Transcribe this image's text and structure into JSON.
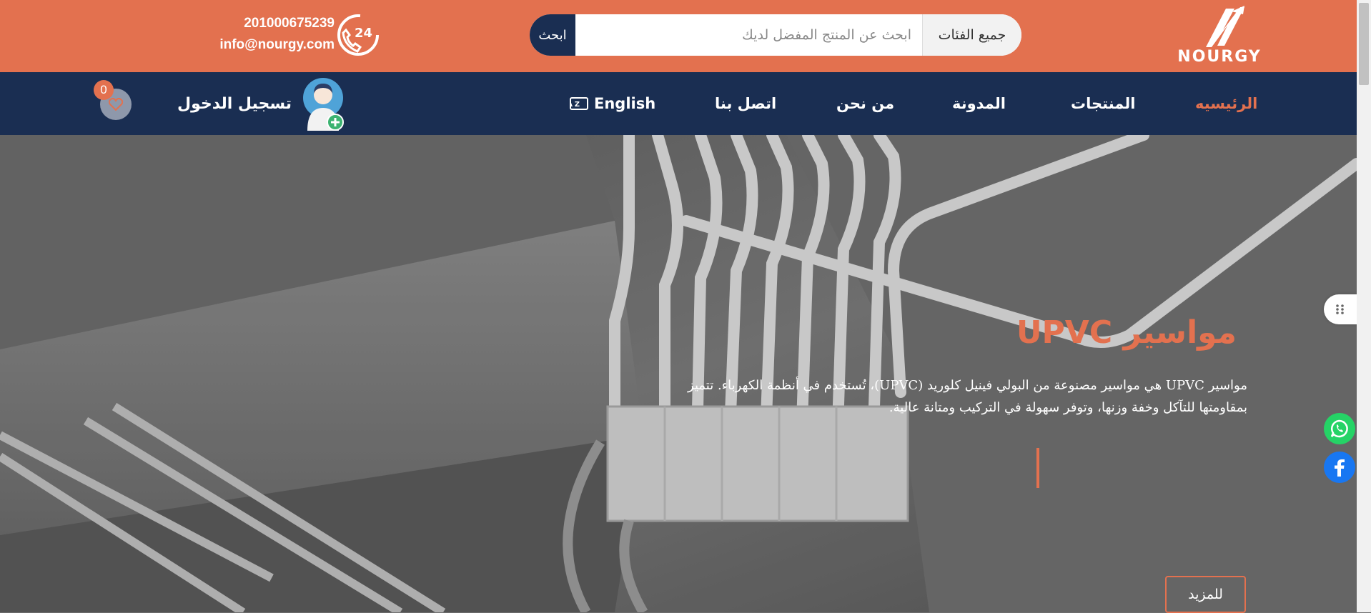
{
  "header": {
    "logo_text": "NOURGY",
    "phone": "201000675239",
    "email": "info@nourgy.com",
    "search": {
      "button_label": "ابحث",
      "placeholder": "ابحث عن المنتج المفضل لديك",
      "category_label": "جميع الفئات"
    }
  },
  "nav": {
    "items": [
      {
        "label": "الرئيسيه",
        "active": true
      },
      {
        "label": "المنتجات"
      },
      {
        "label": "المدونة"
      },
      {
        "label": "من نحن"
      },
      {
        "label": "اتصل بنا"
      },
      {
        "label": "English"
      }
    ],
    "login_label": "تسجيل الدخول",
    "wishlist_count": "0"
  },
  "hero": {
    "title": "مواسير UPVC",
    "description": "مواسير UPVC هي مواسير مصنوعة من البولي فينيل كلوريد (UPVC)، تُستخدم في أنظمة الكهرباء. تتميز بمقاومتها للتآكل وخفة وزنها، وتوفر سهولة في التركيب ومتانة عالية.",
    "more_label": "للمزيد"
  },
  "colors": {
    "accent": "#e3714f",
    "navy": "#1a2e52"
  }
}
